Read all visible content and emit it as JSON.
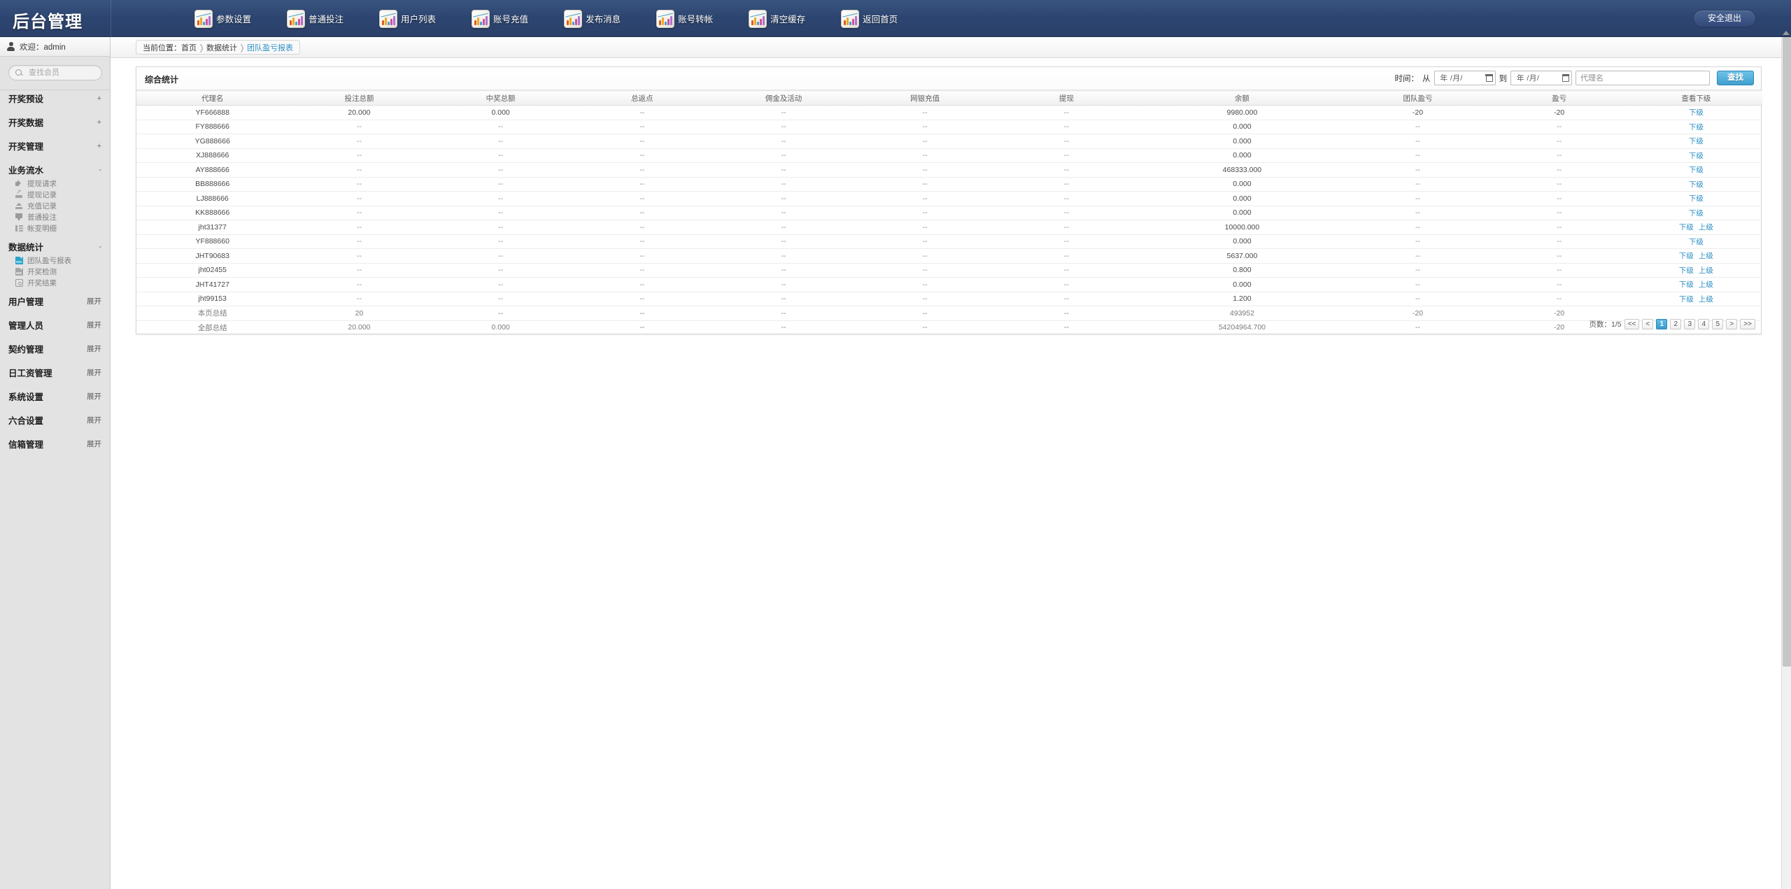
{
  "header": {
    "brand_title": "后台管理",
    "logout_label": "安全退出",
    "nav_items": [
      {
        "label": "参数设置",
        "icon": "chart-icon"
      },
      {
        "label": "普通投注",
        "icon": "chart-icon"
      },
      {
        "label": "用户列表",
        "icon": "chart-icon"
      },
      {
        "label": "账号充值",
        "icon": "chart-icon"
      },
      {
        "label": "发布消息",
        "icon": "chart-icon"
      },
      {
        "label": "账号转帐",
        "icon": "chart-icon"
      },
      {
        "label": "清空缓存",
        "icon": "chart-icon"
      },
      {
        "label": "返回首页",
        "icon": "chart-icon"
      }
    ]
  },
  "sidebar": {
    "welcome": "欢迎：admin",
    "search_placeholder": "查找会员",
    "search_value": "",
    "groups": [
      {
        "label": "开奖预设",
        "expander": "+",
        "items": []
      },
      {
        "label": "开奖数据",
        "expander": "+",
        "items": []
      },
      {
        "label": "开奖管理",
        "expander": "+",
        "items": []
      },
      {
        "label": "业务流水",
        "expander": "-",
        "items": [
          {
            "label": "提现请求",
            "icon": "speaker-icon"
          },
          {
            "label": "提现记录",
            "icon": "arrow-up-icon"
          },
          {
            "label": "充值记录",
            "icon": "chart-up-icon"
          },
          {
            "label": "普通投注",
            "icon": "badge-icon"
          },
          {
            "label": "帐变明细",
            "icon": "list-icon"
          }
        ]
      },
      {
        "label": "数据统计",
        "expander": "-",
        "items": [
          {
            "label": "团队盈亏报表",
            "icon": "report-blue-icon"
          },
          {
            "label": "开奖检测",
            "icon": "report-gray-icon"
          },
          {
            "label": "开奖结果",
            "icon": "target-icon"
          }
        ]
      },
      {
        "label": "用户管理",
        "expander": "展开",
        "items": []
      },
      {
        "label": "管理人员",
        "expander": "展开",
        "items": []
      },
      {
        "label": "契约管理",
        "expander": "展开",
        "items": []
      },
      {
        "label": "日工资管理",
        "expander": "展开",
        "items": []
      },
      {
        "label": "系统设置",
        "expander": "展开",
        "items": []
      },
      {
        "label": "六合设置",
        "expander": "展开",
        "items": []
      },
      {
        "label": "信箱管理",
        "expander": "展开",
        "items": []
      }
    ]
  },
  "breadcrumb": {
    "prefix": "当前位置：",
    "items": [
      "首页",
      "数据统计"
    ],
    "current": "团队盈亏报表"
  },
  "panel": {
    "title": "综合统计",
    "filter": {
      "time_label": "时间：",
      "from_label": "从",
      "to_label": "到",
      "date_from": "年 /月/",
      "date_to": "年 /月/",
      "agent_placeholder": "代理名",
      "agent_value": "",
      "search_label": "查找"
    },
    "columns": [
      "代理名",
      "投注总额",
      "中奖总额",
      "总返点",
      "佣金及活动",
      "网银充值",
      "提现",
      "余额",
      "团队盈亏",
      "盈亏",
      "查看下级"
    ],
    "rows": [
      {
        "agent": "YF666888",
        "bet": "20.000",
        "win": "0.000",
        "rebate": "--",
        "commission": "--",
        "deposit": "--",
        "withdraw": "--",
        "balance": "9980.000",
        "team_pl": "-20",
        "pl": "-20",
        "links": [
          "下级"
        ]
      },
      {
        "agent": "FY888666",
        "bet": "--",
        "win": "--",
        "rebate": "--",
        "commission": "--",
        "deposit": "--",
        "withdraw": "--",
        "balance": "0.000",
        "team_pl": "--",
        "pl": "--",
        "links": [
          "下级"
        ]
      },
      {
        "agent": "YG888666",
        "bet": "--",
        "win": "--",
        "rebate": "--",
        "commission": "--",
        "deposit": "--",
        "withdraw": "--",
        "balance": "0.000",
        "team_pl": "--",
        "pl": "--",
        "links": [
          "下级"
        ]
      },
      {
        "agent": "XJ888666",
        "bet": "--",
        "win": "--",
        "rebate": "--",
        "commission": "--",
        "deposit": "--",
        "withdraw": "--",
        "balance": "0.000",
        "team_pl": "--",
        "pl": "--",
        "links": [
          "下级"
        ]
      },
      {
        "agent": "AY888666",
        "bet": "--",
        "win": "--",
        "rebate": "--",
        "commission": "--",
        "deposit": "--",
        "withdraw": "--",
        "balance": "468333.000",
        "team_pl": "--",
        "pl": "--",
        "links": [
          "下级"
        ]
      },
      {
        "agent": "BB888666",
        "bet": "--",
        "win": "--",
        "rebate": "--",
        "commission": "--",
        "deposit": "--",
        "withdraw": "--",
        "balance": "0.000",
        "team_pl": "--",
        "pl": "--",
        "links": [
          "下级"
        ]
      },
      {
        "agent": "LJ888666",
        "bet": "--",
        "win": "--",
        "rebate": "--",
        "commission": "--",
        "deposit": "--",
        "withdraw": "--",
        "balance": "0.000",
        "team_pl": "--",
        "pl": "--",
        "links": [
          "下级"
        ]
      },
      {
        "agent": "KK888666",
        "bet": "--",
        "win": "--",
        "rebate": "--",
        "commission": "--",
        "deposit": "--",
        "withdraw": "--",
        "balance": "0.000",
        "team_pl": "--",
        "pl": "--",
        "links": [
          "下级"
        ]
      },
      {
        "agent": "jht31377",
        "bet": "--",
        "win": "--",
        "rebate": "--",
        "commission": "--",
        "deposit": "--",
        "withdraw": "--",
        "balance": "10000.000",
        "team_pl": "--",
        "pl": "--",
        "links": [
          "下级",
          "上级"
        ]
      },
      {
        "agent": "YF888660",
        "bet": "--",
        "win": "--",
        "rebate": "--",
        "commission": "--",
        "deposit": "--",
        "withdraw": "--",
        "balance": "0.000",
        "team_pl": "--",
        "pl": "--",
        "links": [
          "下级"
        ]
      },
      {
        "agent": "JHT90683",
        "bet": "--",
        "win": "--",
        "rebate": "--",
        "commission": "--",
        "deposit": "--",
        "withdraw": "--",
        "balance": "5637.000",
        "team_pl": "--",
        "pl": "--",
        "links": [
          "下级",
          "上级"
        ]
      },
      {
        "agent": "jht02455",
        "bet": "--",
        "win": "--",
        "rebate": "--",
        "commission": "--",
        "deposit": "--",
        "withdraw": "--",
        "balance": "0.800",
        "team_pl": "--",
        "pl": "--",
        "links": [
          "下级",
          "上级"
        ]
      },
      {
        "agent": "JHT41727",
        "bet": "--",
        "win": "--",
        "rebate": "--",
        "commission": "--",
        "deposit": "--",
        "withdraw": "--",
        "balance": "0.000",
        "team_pl": "--",
        "pl": "--",
        "links": [
          "下级",
          "上级"
        ]
      },
      {
        "agent": "jht99153",
        "bet": "--",
        "win": "--",
        "rebate": "--",
        "commission": "--",
        "deposit": "--",
        "withdraw": "--",
        "balance": "1.200",
        "team_pl": "--",
        "pl": "--",
        "links": [
          "下级",
          "上级"
        ]
      }
    ],
    "totals": [
      {
        "agent": "本页总结",
        "bet": "20",
        "win": "--",
        "rebate": "--",
        "commission": "--",
        "deposit": "--",
        "withdraw": "--",
        "balance": "493952",
        "team_pl": "-20",
        "pl": "-20",
        "links": []
      },
      {
        "agent": "全部总结",
        "bet": "20.000",
        "win": "0.000",
        "rebate": "--",
        "commission": "--",
        "deposit": "--",
        "withdraw": "--",
        "balance": "54204964.700",
        "team_pl": "--",
        "pl": "-20",
        "links": []
      }
    ],
    "pagination": {
      "label": "页数：",
      "current_of_total": "1/5",
      "first": "<<",
      "prev": "<",
      "pages": [
        "1",
        "2",
        "3",
        "4",
        "5"
      ],
      "next": ">",
      "last": ">>",
      "active_page": "1"
    }
  },
  "colors": {
    "header_blue": "#2c4570",
    "accent_link": "#2e90c4",
    "button_blue": "#3f9fd0",
    "sidebar_bg": "#e3e3e3"
  }
}
